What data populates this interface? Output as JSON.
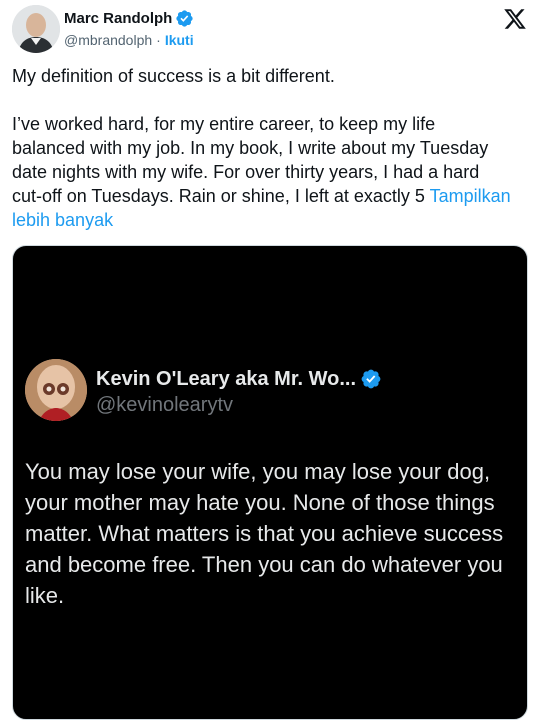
{
  "author": {
    "name": "Marc Randolph",
    "handle": "@mbrandolph",
    "separator": "·",
    "follow_label": "Ikuti"
  },
  "tweet": {
    "paragraph1": "My definition of success is a bit different.",
    "paragraph2": "I’ve worked hard, for my entire career, to keep my life balanced with my job. In my book, I write about my Tuesday date nights with my wife. For over thirty years, I had a hard cut-off on Tuesdays. Rain or shine, I left at exactly 5",
    "show_more": "Tampilkan lebih banyak"
  },
  "quoted": {
    "name": "Kevin O'Leary aka Mr. Wo...",
    "handle": "@kevinolearytv",
    "text": "You may lose your wife, you may lose your dog, your mother may hate you. None of those things matter. What matters is that you achieve success and become free. Then you can do whatever you like."
  },
  "colors": {
    "link": "#1d9bf0",
    "text": "#0f1419",
    "secondary": "#536471",
    "media_bg": "#000000"
  },
  "icons": {
    "verified": "verified-badge-icon",
    "platform": "x-logo-icon"
  }
}
